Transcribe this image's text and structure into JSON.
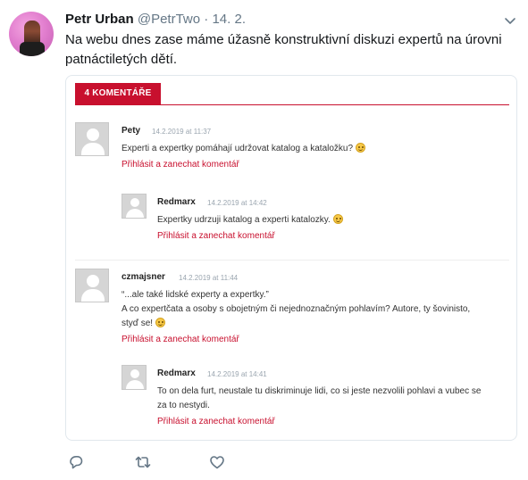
{
  "tweet": {
    "author": "Petr Urban",
    "handle": "@PetrTwo",
    "separator": "·",
    "date": "14. 2.",
    "text_line1": "Na webu dnes zase máme úžasně konstruktivní diskuzi expertů na úrovni",
    "text_line2": "patnáctiletých dětí."
  },
  "card": {
    "badge": "4 KOMENTÁŘE",
    "comments": [
      {
        "name": "Pety",
        "date": "14.2.2019 at 11:37",
        "lines": [
          "Experti a expertky pomáhají udržovat katalog a kataložku?"
        ],
        "emoji": "smiley",
        "link": "Přihlásit a zanechat komentář"
      },
      {
        "name": "Redmarx",
        "date": "14.2.2019 at 14:42",
        "lines": [
          "Expertky udrzuji katalog a experti katalozky."
        ],
        "emoji": "smiley",
        "link": "Přihlásit a zanechat komentář"
      },
      {
        "name": "czmajsner",
        "date": "14.2.2019 at 11:44",
        "lines": [
          "“...ale také lidské experty a expertky.”",
          "A co expertčata a osoby s obojetným či nejednoznačným pohlavím? Autore, ty šovinisto,",
          "styď se!"
        ],
        "emoji": "grin",
        "link": "Přihlásit a zanechat komentář"
      },
      {
        "name": "Redmarx",
        "date": "14.2.2019 at 14:41",
        "lines": [
          "To on dela furt, neustale tu diskriminuje lidi, co si jeste nezvolili pohlavi a vubec se",
          "za to nestydi."
        ],
        "link": "Přihlásit a zanechat komentář"
      }
    ]
  },
  "actions": {
    "icons": [
      "reply-icon",
      "retweet-icon",
      "like-icon"
    ]
  },
  "colors": {
    "accent": "#c8102e",
    "muted": "#657786",
    "icon": "#657786"
  }
}
